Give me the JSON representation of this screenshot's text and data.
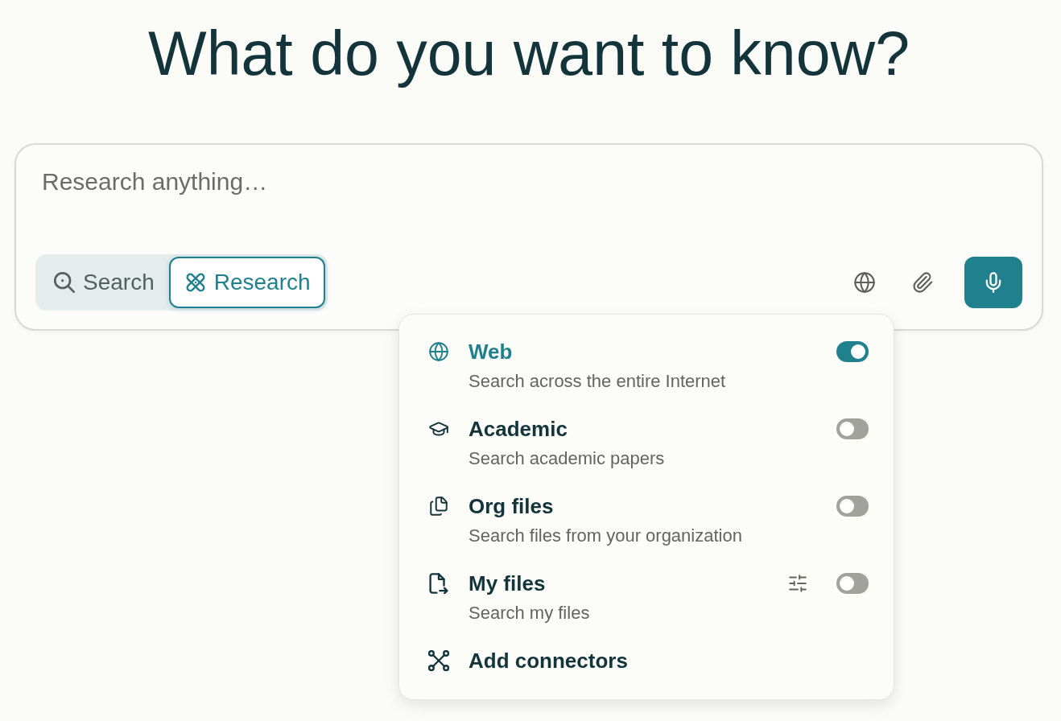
{
  "heading": "What do you want to know?",
  "query": {
    "placeholder": "Research anything…"
  },
  "modes": [
    {
      "label": "Search",
      "selected": false
    },
    {
      "label": "Research",
      "selected": true
    }
  ],
  "sources_menu": {
    "items": [
      {
        "kind": "toggle",
        "title": "Web",
        "description": "Search across the entire Internet",
        "on": true,
        "settings": false
      },
      {
        "kind": "toggle",
        "title": "Academic",
        "description": "Search academic papers",
        "on": false,
        "settings": false
      },
      {
        "kind": "toggle",
        "title": "Org files",
        "description": "Search files from your organization",
        "on": false,
        "settings": false
      },
      {
        "kind": "toggle",
        "title": "My files",
        "description": "Search my files",
        "on": false,
        "settings": true
      },
      {
        "kind": "action",
        "title": "Add connectors"
      }
    ]
  }
}
